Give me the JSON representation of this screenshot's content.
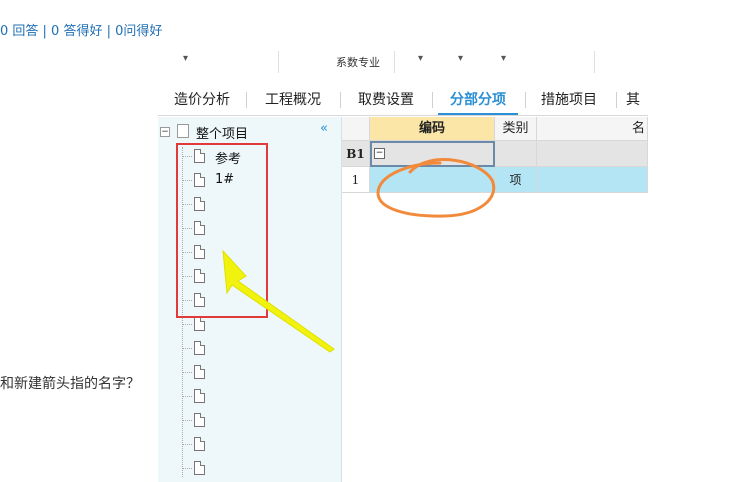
{
  "page": {
    "stats": "0 回答 | 0 答得好 | 0问得好",
    "question": "和新建箭头指的名字？"
  },
  "app": {
    "subject_dropdown": "系数专业",
    "tabs": [
      {
        "label": "造价分析"
      },
      {
        "label": "工程概况"
      },
      {
        "label": "取费设置"
      },
      {
        "label": "分部分项"
      },
      {
        "label": "措施项目"
      },
      {
        "label": "其"
      }
    ],
    "active_tab": "分部分项",
    "tree": {
      "root_label": "整个项目",
      "expander": "⊟",
      "collapse_icon": "«",
      "items": [
        "参考",
        "1#",
        "",
        "",
        "",
        "",
        "",
        "",
        "",
        "",
        "",
        "",
        "",
        "",
        ""
      ]
    },
    "grid": {
      "headers": {
        "code": "编码",
        "type": "类别",
        "name": "名"
      },
      "rows": [
        {
          "num": "B1",
          "code": "",
          "type": "",
          "name": ""
        },
        {
          "num": "1",
          "code": "",
          "type": "项",
          "name": ""
        }
      ]
    }
  },
  "colors": {
    "accent": "#2a8fd4",
    "tree_bg": "#eef8fb",
    "header_highlight": "#fbe6a8",
    "row_selected": "#b4e5f5",
    "annotation_box": "#e03a3a",
    "annotation_circle": "#f28a3c",
    "annotation_arrow": "#f2f20f"
  },
  "icons": [
    "expand-collapse-icon",
    "project-icon",
    "document-icon",
    "collapse-panel-icon",
    "dropdown-arrow-icon",
    "minus-icon"
  ]
}
